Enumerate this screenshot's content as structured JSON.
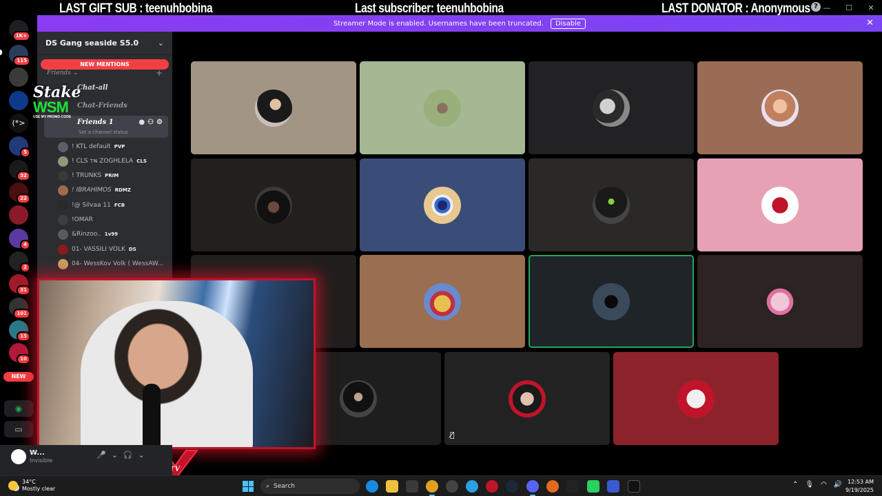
{
  "overlay": {
    "last_gift_sub": "LAST GIFT SUB : teenuhbobina",
    "last_subscriber": "Last subscriber: teenuhbobina",
    "last_donator": "LAST DONATOR : Anonymous"
  },
  "banner": {
    "message": "Streamer Mode is enabled. Usernames have been truncated.",
    "button": "Disable"
  },
  "window_controls": {
    "minimize": "—",
    "maximize": "☐",
    "close": "✕"
  },
  "rail": {
    "servers": [
      {
        "badge": "1K+"
      },
      {
        "badge": "115"
      },
      {
        "badge": ""
      },
      {
        "badge": ""
      },
      {
        "badge": ""
      },
      {
        "badge": "5"
      },
      {
        "badge": "32"
      },
      {
        "badge": "22"
      },
      {
        "badge": ""
      },
      {
        "badge": "4"
      },
      {
        "badge": "2"
      },
      {
        "badge": "31"
      },
      {
        "badge": "101"
      },
      {
        "badge": "15"
      },
      {
        "badge": "10"
      }
    ],
    "new_label": "NEW"
  },
  "sidebar": {
    "guild_name": "DS Gang seaside S5.0",
    "new_mentions": "NEW MENTIONS",
    "category": "Friends",
    "channels": [
      {
        "label": "Chat-all"
      },
      {
        "label": "Chat-Friends"
      },
      {
        "label": "Friends 1"
      }
    ],
    "channel_status": "Set a channel status",
    "members": [
      {
        "name": "! KTL default",
        "tag": "PVP"
      },
      {
        "name": "! CLS ᴛɴ ZOGHLELA",
        "tag": "CLS"
      },
      {
        "name": "! TRUNKS",
        "tag": "PRIM"
      },
      {
        "name": "! IBRAHIMOS",
        "tag": "RDMZ"
      },
      {
        "name": "!@ Silvaa 11",
        "tag": "FCB"
      },
      {
        "name": "!OMAR",
        "tag": ""
      },
      {
        "name": "&Rinzoo..",
        "tag": "1v99"
      },
      {
        "name": "01- VASSILI VOLK",
        "tag": "DS"
      },
      {
        "name": "04- WessKov Volk ( WessAW...",
        "tag": ""
      }
    ]
  },
  "user_panel": {
    "name": "W...",
    "status": "Invisible"
  },
  "stake_overlay": {
    "line1": "Stake",
    "line2": "WSM",
    "line3": "USE MY PROMO CODE"
  },
  "webcam_logo": "TV",
  "taskbar": {
    "temperature": "34°C",
    "condition": "Mostly clear",
    "search_placeholder": "Search",
    "time": "12:53 AM",
    "date": "9/19/2025"
  },
  "colors": {
    "banner": "#8a3cf2",
    "mention_red": "#f23f43",
    "speaking_green": "#23a559",
    "webcam_border": "#c0142a"
  }
}
